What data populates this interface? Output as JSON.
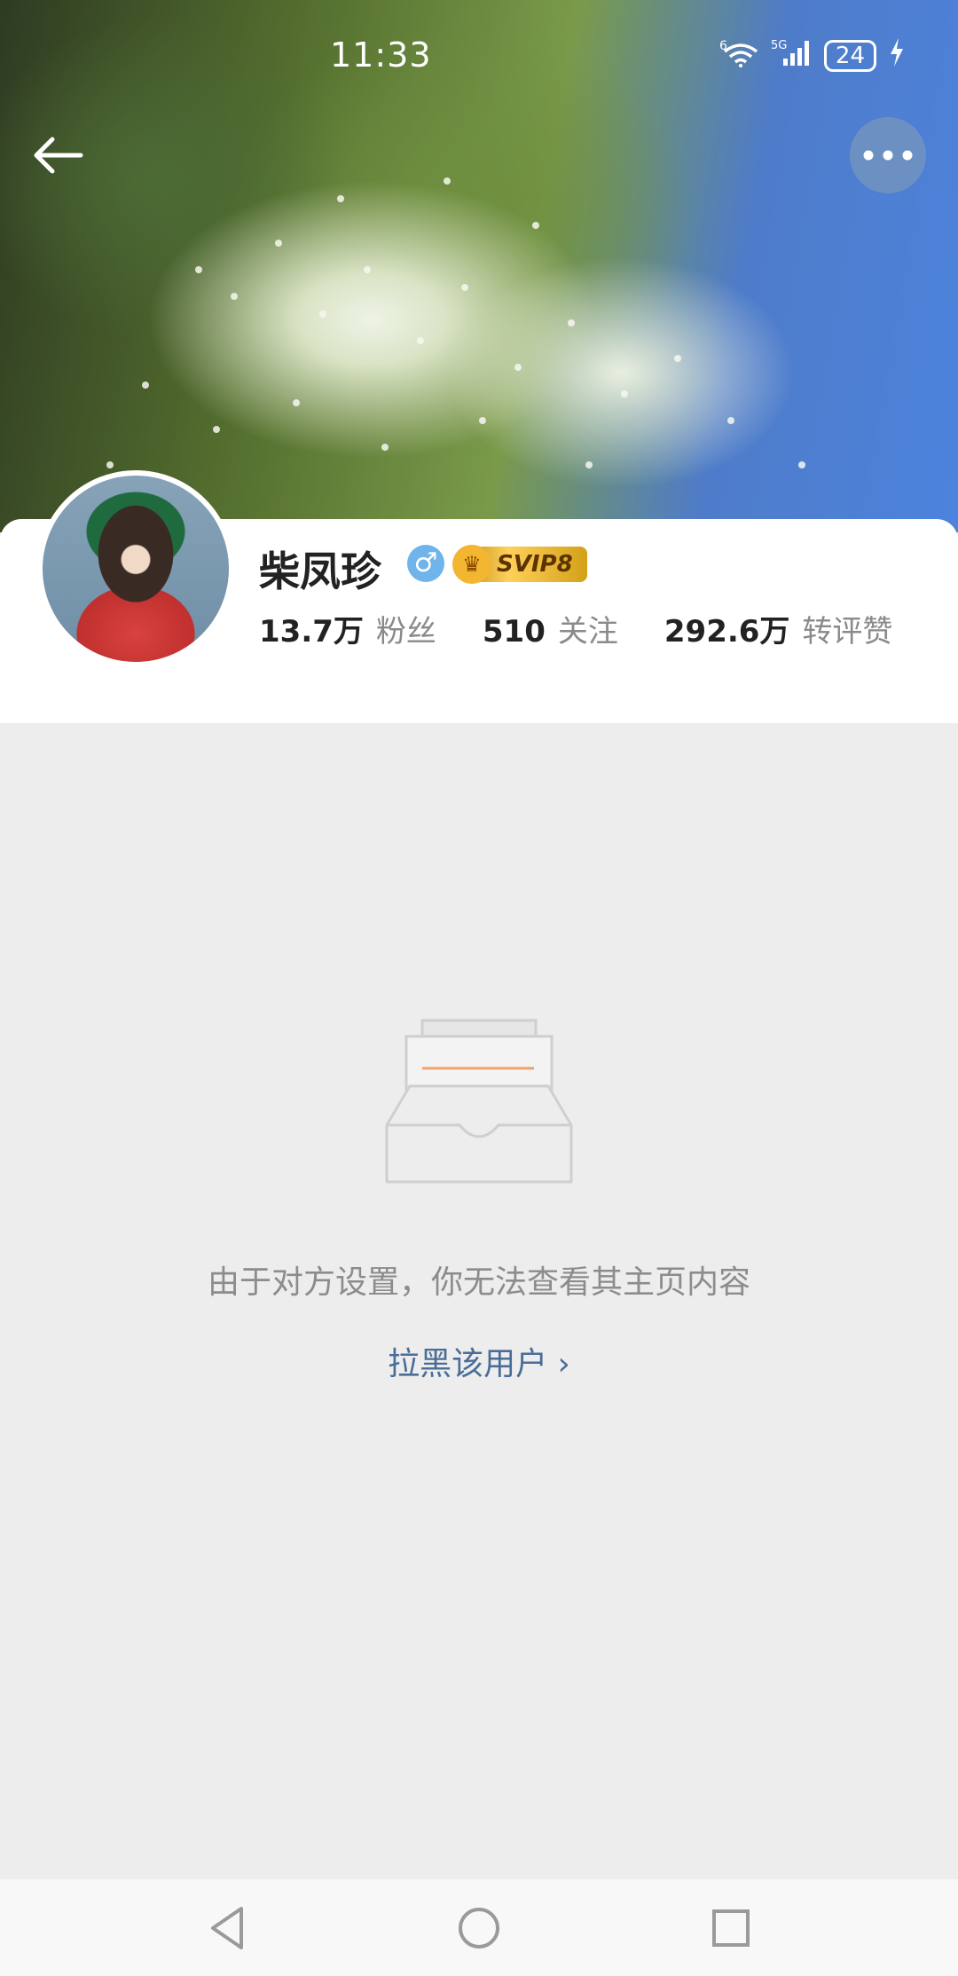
{
  "status_bar": {
    "time": "11:33",
    "wifi_label": "6",
    "network_label": "5G",
    "battery": "24"
  },
  "header": {
    "back_icon": "arrow-left-icon",
    "more_icon": "more-horizontal-icon"
  },
  "profile": {
    "name": "柴凤珍",
    "gender_symbol": "♂",
    "vip_label": "SVIP8",
    "stats": [
      {
        "value": "13.7万",
        "label": "粉丝"
      },
      {
        "value": "510",
        "label": "关注"
      },
      {
        "value": "292.6万",
        "label": "转评赞"
      }
    ]
  },
  "empty_state": {
    "message": "由于对方设置，你无法查看其主页内容",
    "action_label": "拉黑该用户",
    "action_chevron": "›"
  },
  "colors": {
    "accent_link": "#4a6d98",
    "gender_badge": "#6fb4ea",
    "vip_gold": "#ffd05a",
    "illustration_orange": "#f3a26b"
  },
  "nav": {
    "back_icon": "triangle-back-icon",
    "home_icon": "circle-home-icon",
    "recent_icon": "square-recent-icon"
  }
}
